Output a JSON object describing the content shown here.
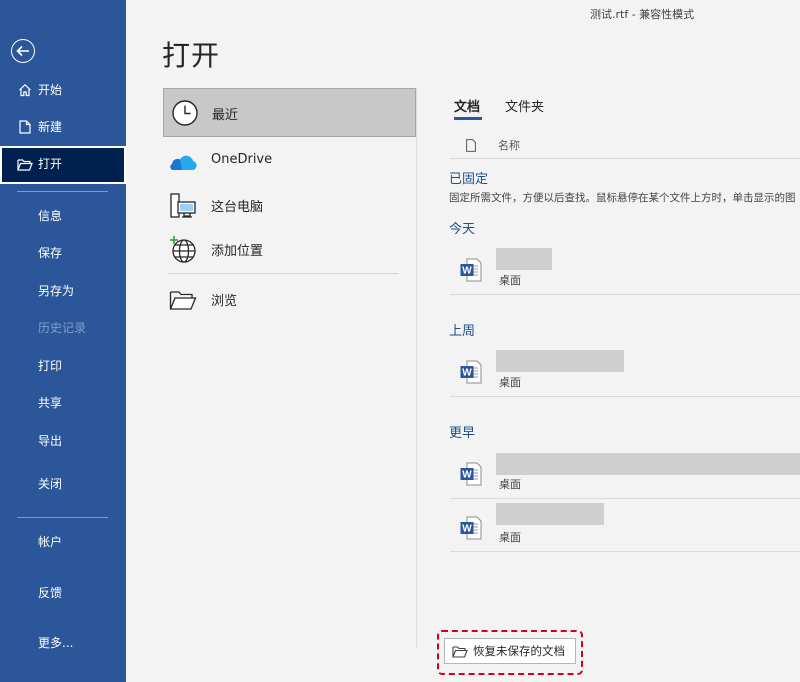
{
  "window": {
    "doc_title": "测试.rtf  -  兼容性模式"
  },
  "page_title": "打开",
  "rail": {
    "back_icon": "back-arrow-icon",
    "items": [
      {
        "label": "开始",
        "icon": "home-icon"
      },
      {
        "label": "新建",
        "icon": "new-doc-icon"
      },
      {
        "label": "打开",
        "icon": "open-folder-icon",
        "selected": true
      },
      {
        "label": "信息"
      },
      {
        "label": "保存"
      },
      {
        "label": "另存为"
      },
      {
        "label": "历史记录",
        "disabled": true
      },
      {
        "label": "打印"
      },
      {
        "label": "共享"
      },
      {
        "label": "导出"
      },
      {
        "label": "关闭"
      },
      {
        "label": "帐户"
      },
      {
        "label": "反馈"
      },
      {
        "label": "更多..."
      }
    ]
  },
  "locations": [
    {
      "label": "最近",
      "icon": "clock-icon",
      "selected": true
    },
    {
      "label": "OneDrive",
      "icon": "onedrive-cloud-icon"
    },
    {
      "label": "这台电脑",
      "icon": "this-pc-icon"
    },
    {
      "label": "添加位置",
      "icon": "add-place-globe-icon"
    },
    {
      "label": "浏览",
      "icon": "browse-folder-icon"
    }
  ],
  "tabs": {
    "documents": "文档",
    "folders": "文件夹",
    "active": "文档"
  },
  "columns": {
    "name": "名称"
  },
  "groups": {
    "pinned": {
      "title": "已固定",
      "hint": "固定所需文件，方便以后查找。鼠标悬停在某个文件上方时，单击显示的图"
    },
    "today": {
      "title": "今天"
    },
    "last_week": {
      "title": "上周"
    },
    "earlier": {
      "title": "更早"
    }
  },
  "files": [
    {
      "group": "today",
      "location": "桌面",
      "icon": "word-doc-icon"
    },
    {
      "group": "last_week",
      "location": "桌面",
      "icon": "word-doc-icon"
    },
    {
      "group": "earlier",
      "location": "桌面",
      "icon": "word-doc-icon"
    },
    {
      "group": "earlier",
      "location": "桌面",
      "icon": "word-doc-icon"
    }
  ],
  "recover_button": {
    "label": "恢复未保存的文档",
    "icon": "folder-open-icon"
  },
  "colors": {
    "rail": "#2b579a",
    "rail_selected": "#002050",
    "accent_text": "#1e4e8c",
    "highlight_frame": "#d0021b"
  }
}
